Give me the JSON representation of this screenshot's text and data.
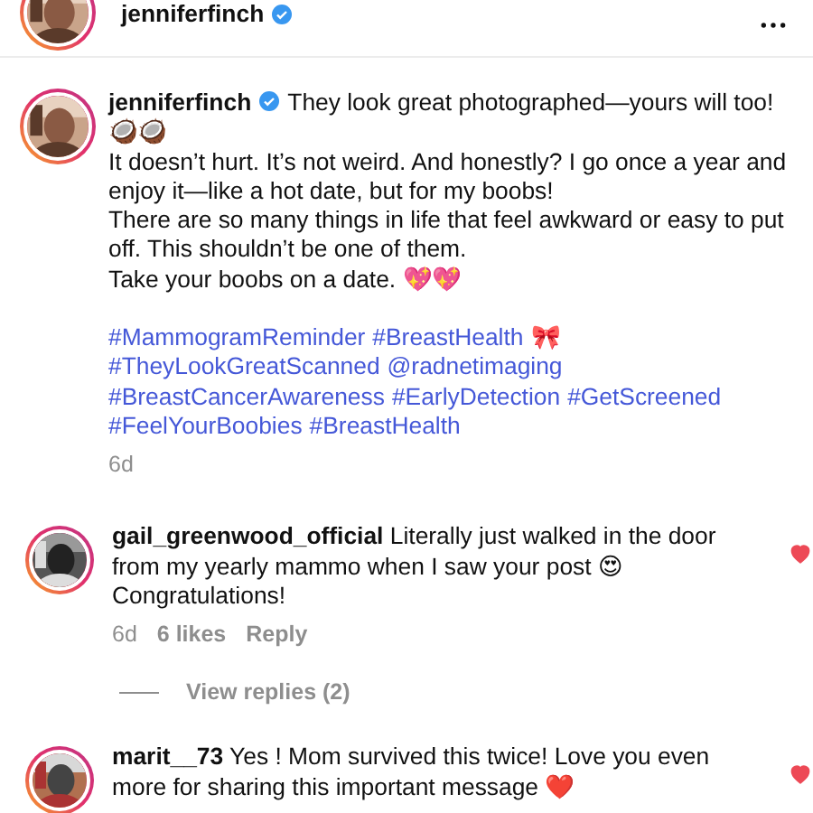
{
  "header": {
    "username": "jenniferfinch",
    "verified": true
  },
  "caption": {
    "username": "jenniferfinch",
    "verified": true,
    "paragraphs": [
      "They look great photographed—yours will too! 🥥🥥",
      "It doesn’t hurt. It’s not weird. And honestly? I go once a year and enjoy it—like a hot date, but for my boobs!",
      "There are so many things in life that feel awkward or easy to put off. This shouldn’t be one of them.",
      " Take your boobs on a date. 💖💖"
    ],
    "tag_lines": [
      [
        {
          "kind": "link",
          "text": "#MammogramReminder"
        },
        {
          "kind": "link",
          "text": "#BreastHealth"
        },
        {
          "kind": "emoji",
          "text": "🎀"
        }
      ],
      [
        {
          "kind": "link",
          "text": "#TheyLookGreatScanned"
        },
        {
          "kind": "link",
          "text": "@radnetimaging"
        }
      ],
      [
        {
          "kind": "link",
          "text": "#BreastCancerAwareness"
        },
        {
          "kind": "link",
          "text": "#EarlyDetection"
        },
        {
          "kind": "link",
          "text": "#GetScreened"
        }
      ],
      [
        {
          "kind": "link",
          "text": "#FeelYourBoobies"
        },
        {
          "kind": "link",
          "text": "#BreastHealth"
        }
      ]
    ],
    "time": "6d"
  },
  "comments": [
    {
      "username": "gail_greenwood_official",
      "text": "Literally just walked in the door from my yearly mammo when I saw your post 😍 Congratulations!",
      "liked": true,
      "time": "6d",
      "likes": "6 likes",
      "reply": "Reply",
      "view_replies": "View replies (2)"
    },
    {
      "username": "marit__73",
      "text": "Yes ! Mom survived this twice! Love you even more for sharing this important message ❤️",
      "liked": true
    }
  ]
}
